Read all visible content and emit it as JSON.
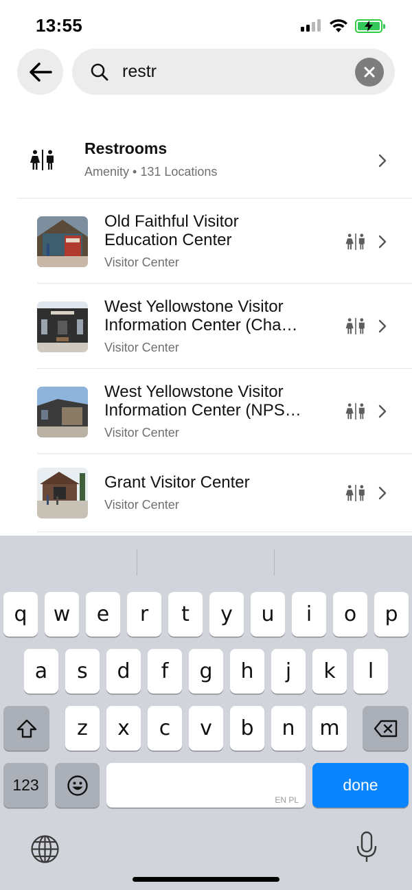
{
  "status_bar": {
    "time": "13:55",
    "signal_icon": "cellular-signal-icon",
    "wifi_icon": "wifi-icon",
    "battery_icon": "battery-charging-icon",
    "battery_color": "#34c759"
  },
  "search": {
    "back_icon": "arrow-left-icon",
    "search_icon": "magnifier-icon",
    "value": "restr",
    "clear_icon": "clear-x-icon"
  },
  "amenity_result": {
    "title": "Restrooms",
    "subtitle": "Amenity • 131 Locations",
    "icon": "restroom-icon"
  },
  "places": [
    {
      "title_line1": "Old Faithful Visitor",
      "title_line2": "Education Center",
      "subtitle": "Visitor Center",
      "amenity_icon": "restroom-icon"
    },
    {
      "title_line1": "West Yellowstone Visitor",
      "title_line2": "Information Center (Cha…",
      "subtitle": "Visitor Center",
      "amenity_icon": "restroom-icon"
    },
    {
      "title_line1": "West Yellowstone Visitor",
      "title_line2": "Information Center (NPS…",
      "subtitle": "Visitor Center",
      "amenity_icon": "restroom-icon"
    },
    {
      "title_line1": "Grant Visitor Center",
      "title_line2": "",
      "subtitle": "Visitor Center",
      "amenity_icon": "restroom-icon"
    }
  ],
  "keyboard": {
    "row1": [
      "q",
      "w",
      "e",
      "r",
      "t",
      "y",
      "u",
      "i",
      "o",
      "p"
    ],
    "row2": [
      "a",
      "s",
      "d",
      "f",
      "g",
      "h",
      "j",
      "k",
      "l"
    ],
    "row3": [
      "z",
      "x",
      "c",
      "v",
      "b",
      "n",
      "m"
    ],
    "numbers_key": "123",
    "emoji_icon": "emoji-icon",
    "shift_icon": "shift-icon",
    "delete_icon": "backspace-icon",
    "space_languages": "EN PL",
    "done_key": "done",
    "done_color": "#0a84ff",
    "globe_icon": "globe-icon",
    "mic_icon": "microphone-icon"
  }
}
